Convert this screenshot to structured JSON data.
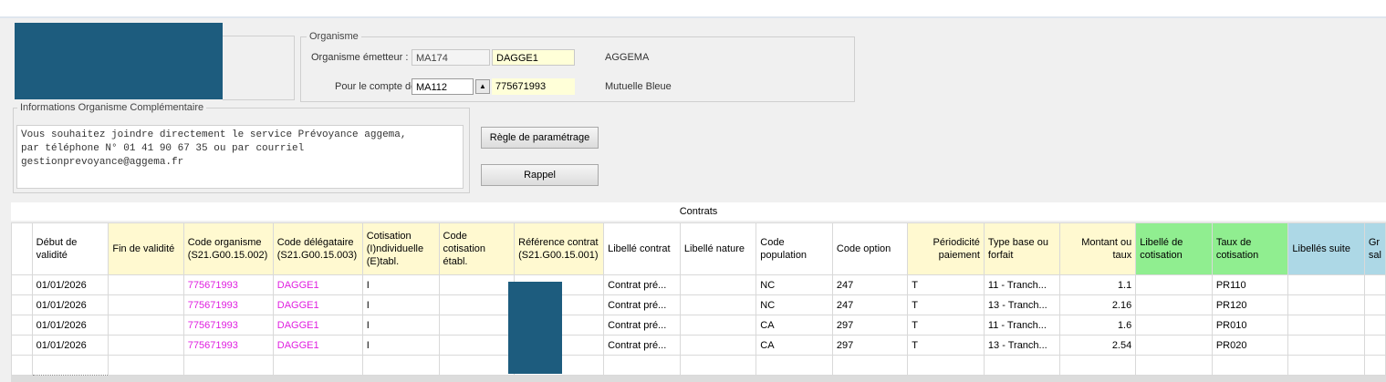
{
  "colors": {
    "redaction": "#1d5c7e",
    "code_link": "#e020e0",
    "header_yellow": "#fff9d0",
    "header_green": "#90ee90",
    "header_blue": "#add8e6"
  },
  "organisme": {
    "legend": "Organisme",
    "emetteur_label": "Organisme émetteur :",
    "emetteur_code": "MA174",
    "emetteur_id": "DAGGE1",
    "emetteur_name": "AGGEMA",
    "compte_label": "Pour le compte de :",
    "compte_code": "MA112",
    "compte_id": "775671993",
    "compte_name": "Mutuelle Bleue"
  },
  "info": {
    "legend": "Informations Organisme Complémentaire",
    "text": "Vous souhaitez joindre directement le service Prévoyance aggema,\npar téléphone N° 01 41 90 67 35 ou par courriel\ngestionprevoyance@aggema.fr"
  },
  "buttons": {
    "regle": "Règle de paramétrage",
    "rappel": "Rappel"
  },
  "contrats": {
    "title": "Contrats",
    "headers": [
      "Début de validité",
      "Fin de validité",
      "Code organisme (S21.G00.15.002)",
      "Code délégataire (S21.G00.15.003)",
      "Cotisation (I)ndividuelle (E)tabl.",
      "Code cotisation établ.",
      "Référence contrat (S21.G00.15.001)",
      "Libellé contrat",
      "Libellé nature",
      "Code population",
      "Code option",
      "Périodicité paiement",
      "Type base ou forfait",
      "Montant ou taux",
      "Libellé de cotisation",
      "Taux de cotisation",
      "Libellés suite",
      "Gr sal"
    ],
    "rows": [
      [
        "01/01/2026",
        "",
        "775671993",
        "DAGGE1",
        "I",
        "",
        "",
        "Contrat pré...",
        "",
        "NC",
        "247",
        "T",
        "11 - Tranch...",
        "1.1",
        "",
        "PR110",
        "",
        ""
      ],
      [
        "01/01/2026",
        "",
        "775671993",
        "DAGGE1",
        "I",
        "",
        "",
        "Contrat pré...",
        "",
        "NC",
        "247",
        "T",
        "13 - Tranch...",
        "2.16",
        "",
        "PR120",
        "",
        ""
      ],
      [
        "01/01/2026",
        "",
        "775671993",
        "DAGGE1",
        "I",
        "",
        "",
        "Contrat pré...",
        "",
        "CA",
        "297",
        "T",
        "11 - Tranch...",
        "1.6",
        "",
        "PR010",
        "",
        ""
      ],
      [
        "01/01/2026",
        "",
        "775671993",
        "DAGGE1",
        "I",
        "",
        "",
        "Contrat pré...",
        "",
        "CA",
        "297",
        "T",
        "13 - Tranch...",
        "2.54",
        "",
        "PR020",
        "",
        ""
      ]
    ]
  }
}
